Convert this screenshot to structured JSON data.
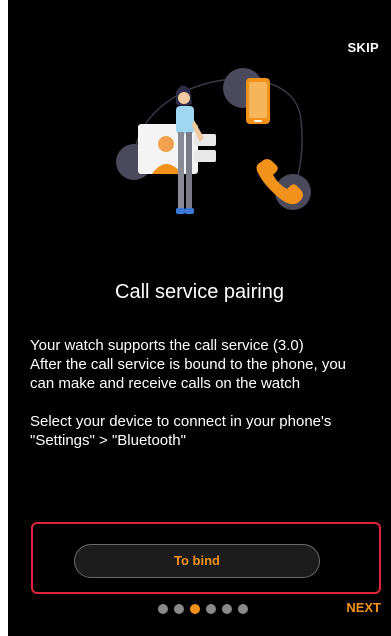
{
  "header": {
    "skip_label": "SKIP"
  },
  "content": {
    "title": "Call service pairing",
    "description_lines": [
      "Your watch supports the call service (3.0)",
      "After the call service is bound to the phone, you",
      "can make and receive calls on the watch"
    ],
    "instruction_lines": [
      "Select your device to connect in your phone's",
      "\"Settings\" > \"Bluetooth\""
    ]
  },
  "actions": {
    "bind_label": "To bind",
    "next_label": "NEXT"
  },
  "pager": {
    "total": 6,
    "active_index": 2
  },
  "illustration": {
    "icons": [
      "person-icon",
      "video-call-card-icon",
      "smartphone-icon",
      "phone-handset-icon"
    ]
  },
  "colors": {
    "accent": "#f2921b",
    "background": "#000000",
    "highlight_border": "#e0243a",
    "dot_inactive": "#8a8a8a"
  }
}
